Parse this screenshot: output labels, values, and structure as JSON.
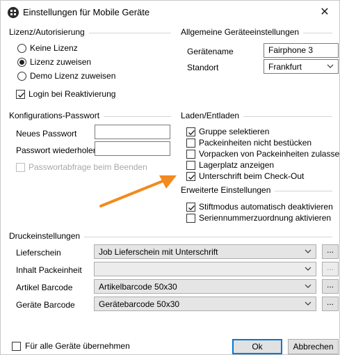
{
  "window": {
    "title": "Einstellungen für Mobile Geräte",
    "close_glyph": "✕"
  },
  "license": {
    "heading": "Lizenz/Autorisierung",
    "options": [
      {
        "label": "Keine Lizenz",
        "selected": false
      },
      {
        "label": "Lizenz zuweisen",
        "selected": true
      },
      {
        "label": "Demo Lizenz zuweisen",
        "selected": false
      }
    ],
    "login_label": "Login bei Reaktivierung",
    "login_checked": true
  },
  "general": {
    "heading": "Allgemeine Geräteeinstellungen",
    "device_name_label": "Gerätename",
    "device_name_value": "Fairphone 3",
    "location_label": "Standort",
    "location_value": "Frankfurt"
  },
  "password": {
    "heading": "Konfigurations-Passwort",
    "new_label": "Neues Passwort",
    "new_value": "",
    "repeat_label": "Passwort wiederholen",
    "repeat_value": "",
    "prompt_label": "Passwortabfrage beim Beenden",
    "prompt_checked": false
  },
  "loading": {
    "heading": "Laden/Entladen",
    "items": [
      {
        "label": "Gruppe selektieren",
        "checked": true
      },
      {
        "label": "Packeinheiten nicht bestücken",
        "checked": false
      },
      {
        "label": "Vorpacken von Packeinheiten zulassen",
        "checked": false
      },
      {
        "label": "Lagerplatz anzeigen",
        "checked": false
      },
      {
        "label": "Unterschrift beim Check-Out",
        "checked": true
      }
    ]
  },
  "advanced": {
    "heading": "Erweiterte Einstellungen",
    "items": [
      {
        "label": "Stiftmodus automatisch deaktivieren",
        "checked": true
      },
      {
        "label": "Seriennummerzuordnung aktivieren",
        "checked": false
      }
    ]
  },
  "print": {
    "heading": "Druckeinstellungen",
    "rows": [
      {
        "label": "Lieferschein",
        "value": "Job Lieferschein mit Unterschrift",
        "enabled": true
      },
      {
        "label": "Inhalt Packeinheit",
        "value": "",
        "enabled": false
      },
      {
        "label": "Artikel Barcode",
        "value": "Artikelbarcode 50x30",
        "enabled": true
      },
      {
        "label": "Geräte Barcode",
        "value": "Gerätebarcode 50x30",
        "enabled": true
      }
    ],
    "browse_label": "..."
  },
  "footer": {
    "apply_all_label": "Für alle Geräte übernehmen",
    "apply_all_checked": false,
    "ok_label": "Ok",
    "cancel_label": "Abbrechen"
  },
  "colors": {
    "arrow": "#f28a1e",
    "accent": "#0078d7"
  }
}
